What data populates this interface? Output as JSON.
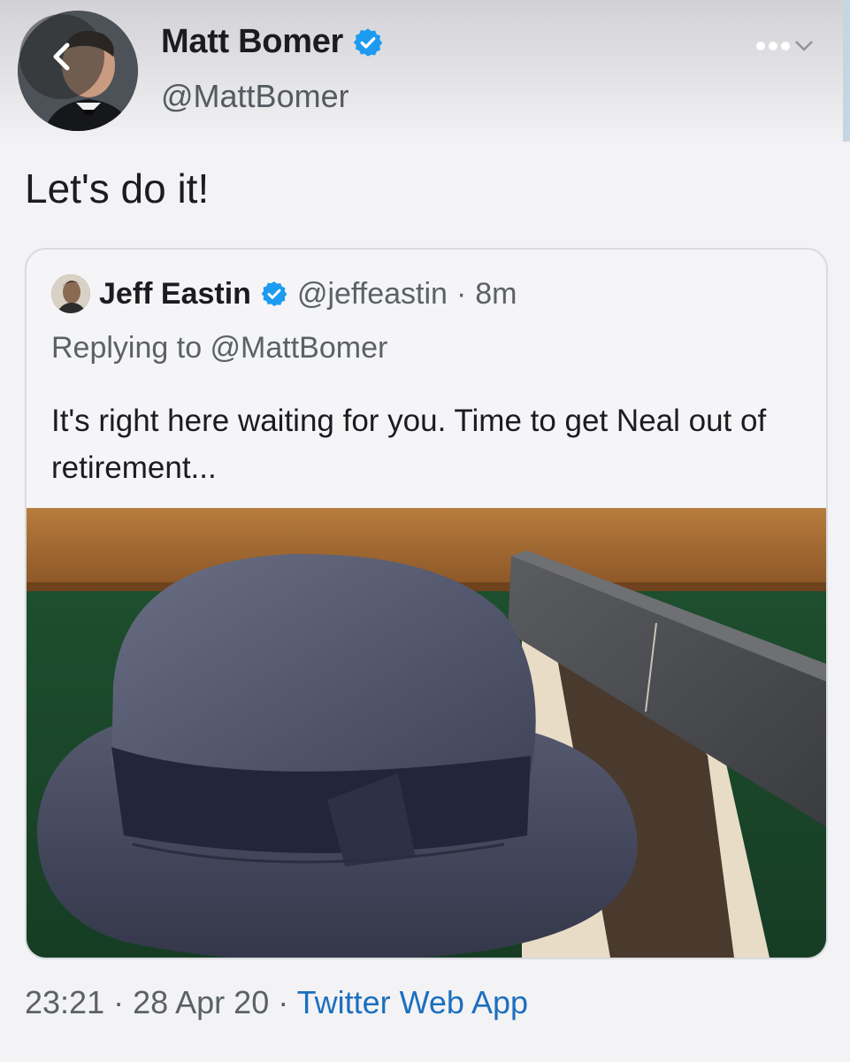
{
  "colors": {
    "background": "#f3f3f5",
    "verified": "#1d9bf0",
    "link": "#1d6fbf",
    "muted_text": "#5b6167"
  },
  "header": {
    "back_icon": "chevron-left-icon",
    "more_icon": "more-options-icon",
    "author": {
      "display_name": "Matt Bomer",
      "handle": "@MattBomer",
      "verified": true
    }
  },
  "tweet": {
    "text": "Let's do it!"
  },
  "quoted_tweet": {
    "display_name": "Jeff Eastin",
    "verified": true,
    "handle": "@jeffeastin",
    "separator": "·",
    "time_ago": "8m",
    "replying_prefix": "Replying to ",
    "replying_to": "@MattBomer",
    "text": "It's right here waiting for you. Time to get Neal out of retirement...",
    "media_icon": "fedora-hat-photo"
  },
  "footer": {
    "time": "23:21",
    "separator_1": " · ",
    "date": "28 Apr 20",
    "separator_2": " · ",
    "source": "Twitter Web App"
  }
}
